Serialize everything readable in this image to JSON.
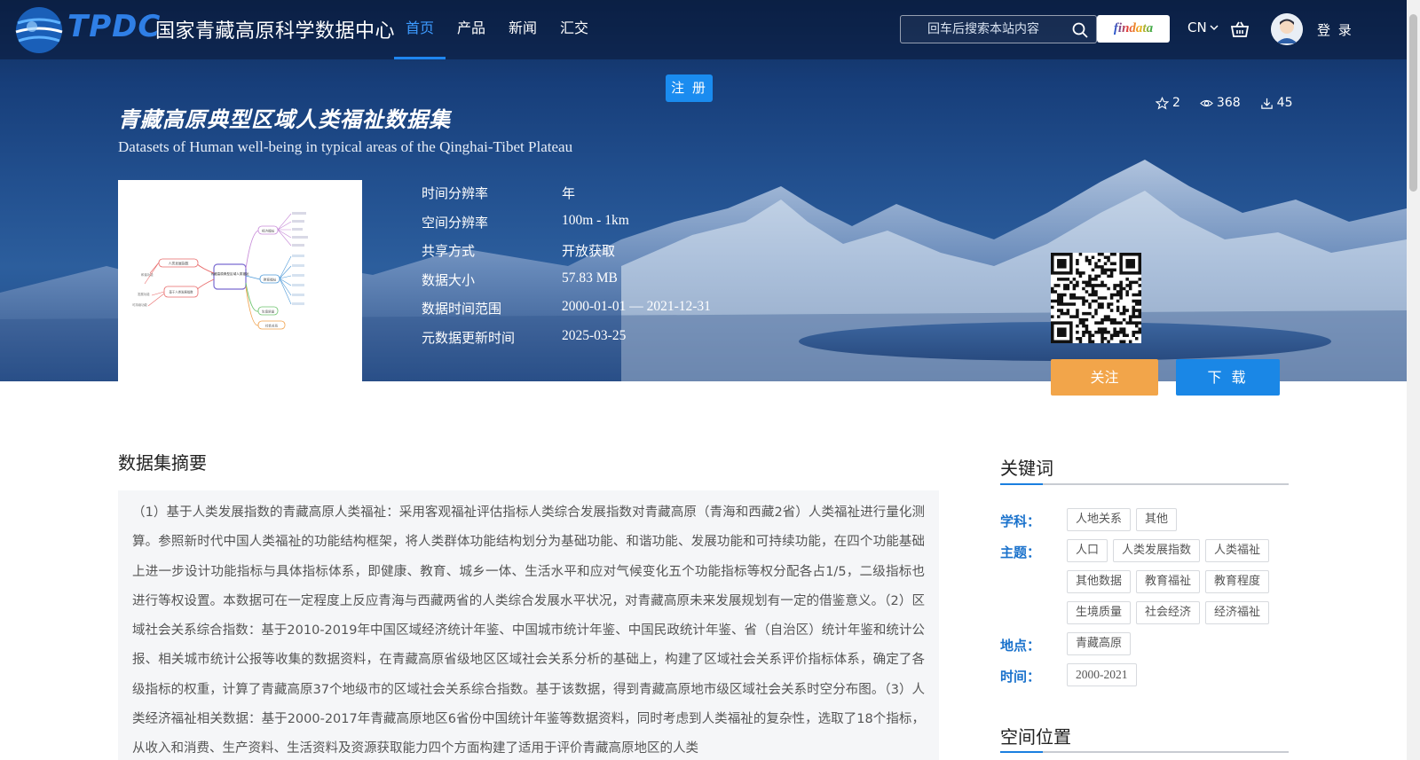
{
  "header": {
    "logo_abbr": "TPDC",
    "logo_name": "国家青藏高原科学数据中心",
    "nav": [
      {
        "label": "首页",
        "active": true
      },
      {
        "label": "产品",
        "active": false
      },
      {
        "label": "新闻",
        "active": false
      },
      {
        "label": "汇交",
        "active": false
      }
    ],
    "search_placeholder": "回车后搜索本站内容",
    "findata_label": "findata",
    "lang_label": "CN",
    "login_label": "登 录"
  },
  "register_label": "注 册",
  "dataset": {
    "title_cn": "青藏高原典型区域人类福祉数据集",
    "title_en": "Datasets of Human well-being in typical areas of the Qinghai-Tibet Plateau",
    "stats": {
      "favorites": "2",
      "views": "368",
      "downloads": "45"
    },
    "meta": [
      {
        "label": "时间分辨率",
        "value": "年",
        "cn": true
      },
      {
        "label": "空间分辨率",
        "value": "100m - 1km",
        "cn": false
      },
      {
        "label": "共享方式",
        "value": "开放获取",
        "cn": true
      },
      {
        "label": "数据大小",
        "value": "57.83 MB",
        "cn": false
      },
      {
        "label": "数据时间范围",
        "value": "2000-01-01 — 2021-12-31",
        "cn": false
      },
      {
        "label": "元数据更新时间",
        "value": "2025-03-25",
        "cn": false
      }
    ],
    "follow_label": "关注",
    "download_label": "下 载"
  },
  "abstract": {
    "title": "数据集摘要",
    "text": "（1）基于人类发展指数的青藏高原人类福祉：采用客观福祉评估指标人类综合发展指数对青藏高原（青海和西藏2省）人类福祉进行量化测算。参照新时代中国人类福祉的功能结构框架，将人类群体功能结构划分为基础功能、和谐功能、发展功能和可持续功能，在四个功能基础上进一步设计功能指标与具体指标体系，即健康、教育、城乡一体、生活水平和应对气候变化五个功能指标等权分配各占1/5，二级指标也进行等权设置。本数据可在一定程度上反应青海与西藏两省的人类综合发展水平状况，对青藏高原未来发展规划有一定的借鉴意义。（2）区域社会关系综合指数：基于2010-2019年中国区域经济统计年鉴、中国城市统计年鉴、中国民政统计年鉴、省（自治区）统计年鉴和统计公报、相关城市统计公报等收集的数据资料，在青藏高原省级地区区域社会关系分析的基础上，构建了区域社会关系评价指标体系，确定了各级指标的权重，计算了青藏高原37个地级市的区域社会关系综合指数。基于该数据，得到青藏高原地市级区域社会关系时空分布图。（3）人类经济福祉相关数据：基于2000-2017年青藏高原地区6省份中国统计年鉴等数据资料，同时考虑到人类福祉的复杂性，选取了18个指标，从收入和消费、生产资料、生活资料及资源获取能力四个方面构建了适用于评价青藏高原地区的人类"
  },
  "keywords": {
    "title": "关键词",
    "groups": [
      {
        "label": "学科：",
        "tags": [
          "人地关系",
          "其他"
        ]
      },
      {
        "label": "主题：",
        "tags": [
          "人口",
          "人类发展指数",
          "人类福祉",
          "其他数据",
          "教育福祉",
          "教育程度",
          "生境质量",
          "社会经济",
          "经济福祉"
        ]
      },
      {
        "label": "地点：",
        "tags": [
          "青藏高原"
        ]
      },
      {
        "label": "时间：",
        "tags": [
          "2000-2021"
        ]
      }
    ]
  },
  "spatial": {
    "title": "空间位置"
  },
  "thumb_diagram": {
    "center": "青藏高原典型区域人类福祉",
    "left_nodes": [
      "人类发展指数",
      "基于人类发展指数",
      "和谐功能",
      "发展功能",
      "可持续功能"
    ],
    "right_nodes": [
      "经济福祉",
      "教育福祉",
      "生境质量",
      "社会关系"
    ]
  },
  "colors": {
    "accent": "#1a87e6",
    "follow": "#f2a54a",
    "nav_active": "#3d9bff",
    "keyword_label": "#1a72cc"
  }
}
